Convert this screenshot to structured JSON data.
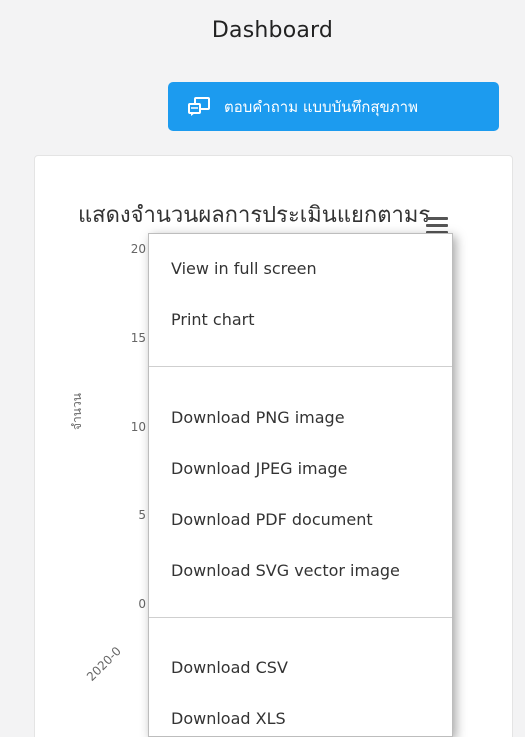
{
  "header": {
    "title": "Dashboard"
  },
  "actions": {
    "survey_button_label": "ตอบคำถาม แบบบันทึกสุขภาพ",
    "survey_button_icon": "chat-icon"
  },
  "colors": {
    "primary": "#1c9bef",
    "background": "#f3f3f4"
  },
  "chart_data": {
    "type": "bar",
    "title": "แสดงจำนวนผลการประเมินแยกตามร",
    "ylabel": "จำนวน",
    "y_ticks": [
      "0",
      "5",
      "10",
      "15",
      "20"
    ],
    "x_ticks": [
      "2020-0"
    ],
    "ylim": [
      0,
      20
    ]
  },
  "menu": {
    "toggle_icon": "hamburger-menu-icon",
    "items": [
      "View in full screen",
      "Print chart",
      "Download PNG image",
      "Download JPEG image",
      "Download PDF document",
      "Download SVG vector image",
      "Download CSV",
      "Download XLS"
    ]
  }
}
